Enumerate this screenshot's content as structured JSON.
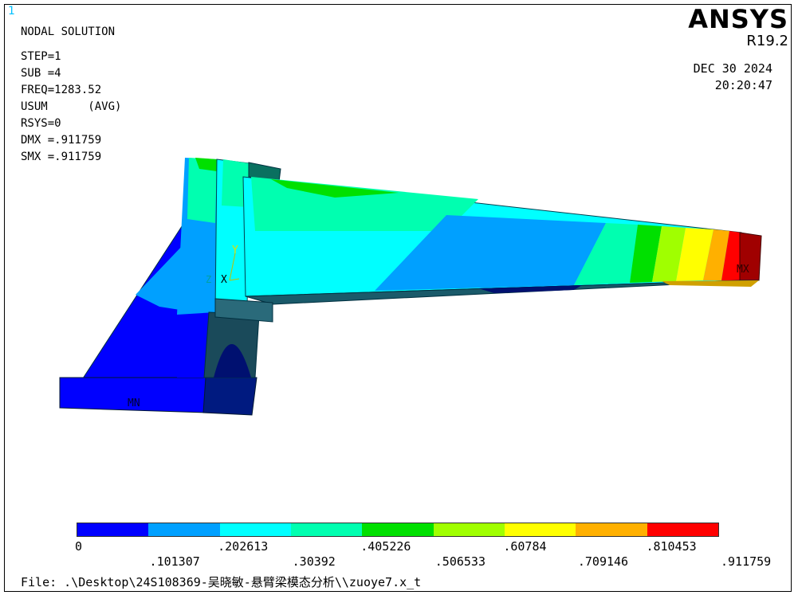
{
  "window_number": "1",
  "logo": {
    "name": "ANSYS",
    "version": "R19.2"
  },
  "info_lines": [
    "NODAL SOLUTION",
    "STEP=1",
    "SUB =4",
    "FREQ=1283.52",
    "USUM      (AVG)",
    "RSYS=0",
    "DMX =.911759",
    "SMX =.911759"
  ],
  "date": "DEC 30 2024",
  "time": "20:20:47",
  "model_labels": {
    "min": "MN",
    "max": "MX",
    "axis_y": "Y",
    "axis_x": "X",
    "axis_z": "Z"
  },
  "legend": {
    "colors": [
      "#0000ff",
      "#00a0ff",
      "#00ffff",
      "#00ffb0",
      "#00e000",
      "#a0ff00",
      "#ffff00",
      "#ffb000",
      "#ff0000"
    ],
    "labels_top": [
      "0",
      ".202613",
      ".405226",
      ".60784",
      ".810453"
    ],
    "labels_bottom": [
      ".101307",
      ".30392",
      ".506533",
      ".709146",
      ".911759"
    ]
  },
  "footer": "File: .\\Desktop\\24S108369-吴晓敏-悬臂梁模态分析\\\\zuoye7.x_t"
}
